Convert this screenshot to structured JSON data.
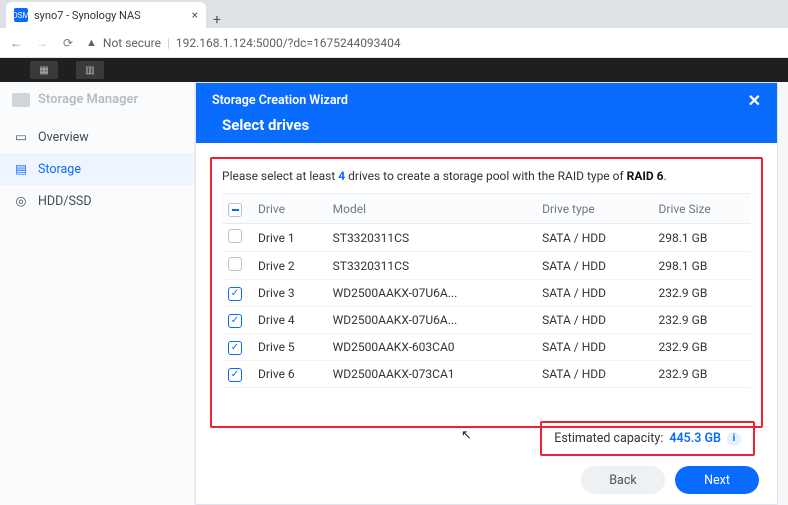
{
  "browser": {
    "tab_title": "syno7 - Synology NAS",
    "favicon_text": "DSM",
    "security_label": "Not secure",
    "url": "192.168.1.124:5000/?dc=1675244093404"
  },
  "sidebar": {
    "app_title": "Storage Manager",
    "items": [
      {
        "label": "Overview",
        "icon": "overview-icon"
      },
      {
        "label": "Storage",
        "icon": "storage-icon"
      },
      {
        "label": "HDD/SSD",
        "icon": "hdd-icon"
      }
    ]
  },
  "wizard": {
    "header": "Storage Creation Wizard",
    "title": "Select drives",
    "hint_pre": "Please select at least ",
    "hint_count": "4",
    "hint_mid": " drives to create a storage pool with the RAID type of ",
    "hint_raid": "RAID 6",
    "hint_post": ".",
    "columns": {
      "c0": "",
      "c1": "Drive",
      "c2": "Model",
      "c3": "Drive type",
      "c4": "Drive Size"
    },
    "rows": [
      {
        "checked": false,
        "drive": "Drive 1",
        "model": "ST3320311CS",
        "type": "SATA / HDD",
        "size": "298.1 GB"
      },
      {
        "checked": false,
        "drive": "Drive 2",
        "model": "ST3320311CS",
        "type": "SATA / HDD",
        "size": "298.1 GB"
      },
      {
        "checked": true,
        "drive": "Drive 3",
        "model": "WD2500AAKX-07U6A...",
        "type": "SATA / HDD",
        "size": "232.9 GB"
      },
      {
        "checked": true,
        "drive": "Drive 4",
        "model": "WD2500AAKX-07U6A...",
        "type": "SATA / HDD",
        "size": "232.9 GB"
      },
      {
        "checked": true,
        "drive": "Drive 5",
        "model": "WD2500AAKX-603CA0",
        "type": "SATA / HDD",
        "size": "232.9 GB"
      },
      {
        "checked": true,
        "drive": "Drive 6",
        "model": "WD2500AAKX-073CA1",
        "type": "SATA / HDD",
        "size": "232.9 GB"
      }
    ],
    "capacity_label": "Estimated capacity:",
    "capacity_value": "445.3 GB",
    "btn_back": "Back",
    "btn_next": "Next"
  }
}
